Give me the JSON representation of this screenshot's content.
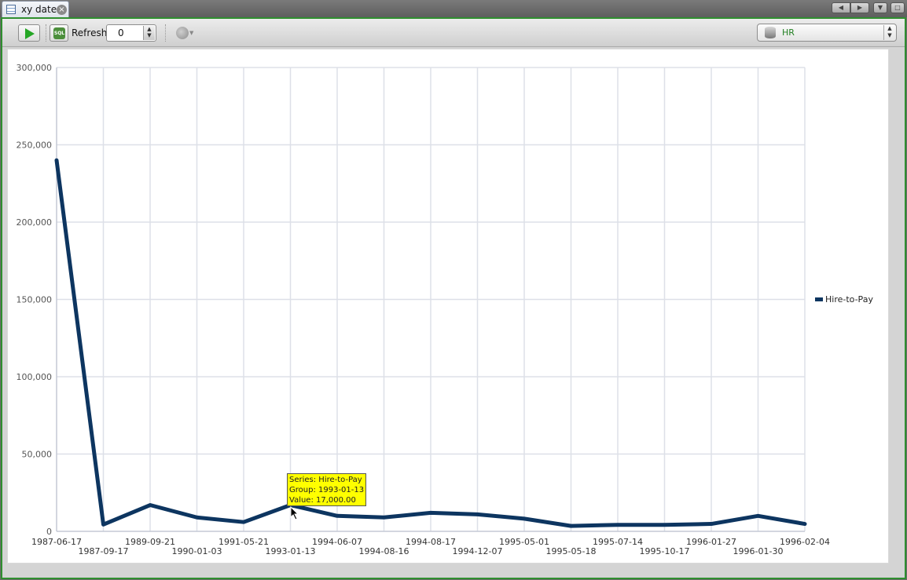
{
  "tab": {
    "title": "xy date"
  },
  "toolbar": {
    "refresh_label": "Refresh:",
    "refresh_value": "0",
    "connection": "HR"
  },
  "colors": {
    "series": "#0d3560",
    "frame": "#2f8f2f",
    "tooltip_bg": "#ffff00",
    "connection_text": "#238023"
  },
  "chart_data": {
    "type": "line",
    "x": [
      "1987-06-17",
      "1987-09-17",
      "1989-09-21",
      "1990-01-03",
      "1991-05-21",
      "1993-01-13",
      "1994-06-07",
      "1994-08-16",
      "1994-08-17",
      "1994-12-07",
      "1995-05-01",
      "1995-05-18",
      "1995-07-14",
      "1995-10-17",
      "1996-01-27",
      "1996-01-30",
      "1996-02-04"
    ],
    "series": [
      {
        "name": "Hire-to-Pay",
        "values": [
          240000,
          4400,
          17000,
          9000,
          6000,
          17000,
          10000,
          9000,
          12000,
          11000,
          8200,
          3500,
          4200,
          4200,
          4800,
          10000,
          4800
        ]
      }
    ],
    "ylim": [
      0,
      300000
    ],
    "yticks": [
      "0",
      "50,000",
      "100,000",
      "150,000",
      "200,000",
      "250,000",
      "300,000"
    ],
    "grid": true,
    "legend_position": "right",
    "tooltip": {
      "series": "Series: Hire-to-Pay",
      "group": "Group: 1993-01-13",
      "value": "Value: 17,000.00"
    }
  }
}
